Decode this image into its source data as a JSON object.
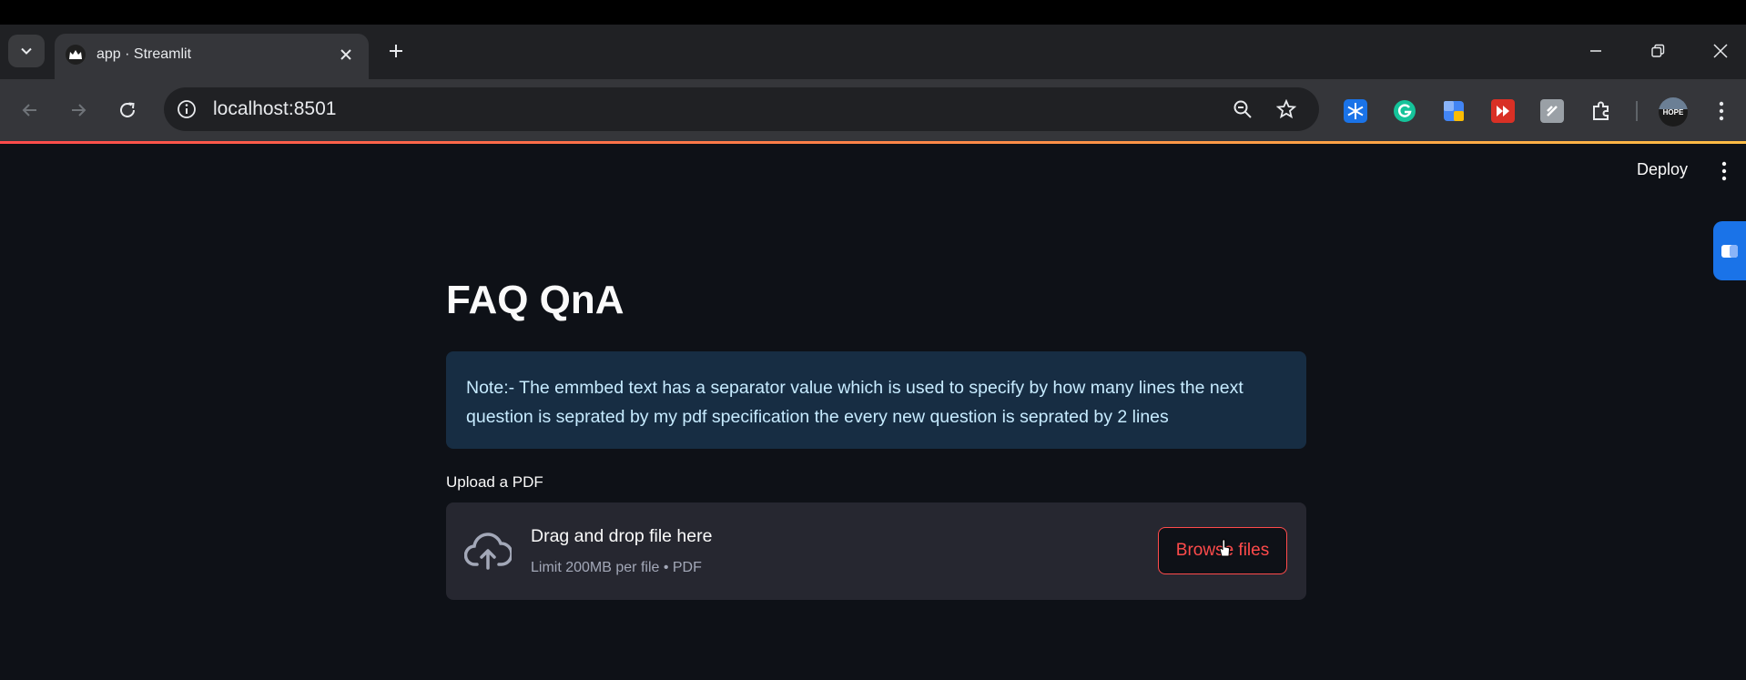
{
  "browser": {
    "tab_title": "app · Streamlit",
    "url": "localhost:8501",
    "extensions": [
      {
        "icon": "snowflake-extension-icon",
        "color": "#1a73e8"
      },
      {
        "icon": "grammarly-extension-icon",
        "color": "#15c39a"
      },
      {
        "icon": "notes-extension-icon",
        "color": "#4285f4"
      },
      {
        "icon": "forward-extension-icon",
        "color": "#d93025"
      },
      {
        "icon": "script-extension-icon",
        "color": "#9aa0a6"
      },
      {
        "icon": "puzzle-extensions-icon",
        "color": "#e8eaed"
      }
    ],
    "profile_label": "HOPE"
  },
  "header": {
    "deploy_label": "Deploy"
  },
  "main": {
    "title": "FAQ QnA",
    "note": "Note:- The emmbed text has a separator value which is used to specify by how many lines the next question is seprated by my pdf specification the every new question is seprated by 2 lines",
    "upload": {
      "label": "Upload a PDF",
      "drop_title": "Drag and drop file here",
      "drop_subtitle": "Limit 200MB per file • PDF",
      "browse_label": "Browse files"
    }
  },
  "colors": {
    "background": "#0e1117",
    "accent": "#ff4b4b",
    "info_bg": "#172d43",
    "info_text": "#c7ebff",
    "dropzone_bg": "#262730"
  }
}
